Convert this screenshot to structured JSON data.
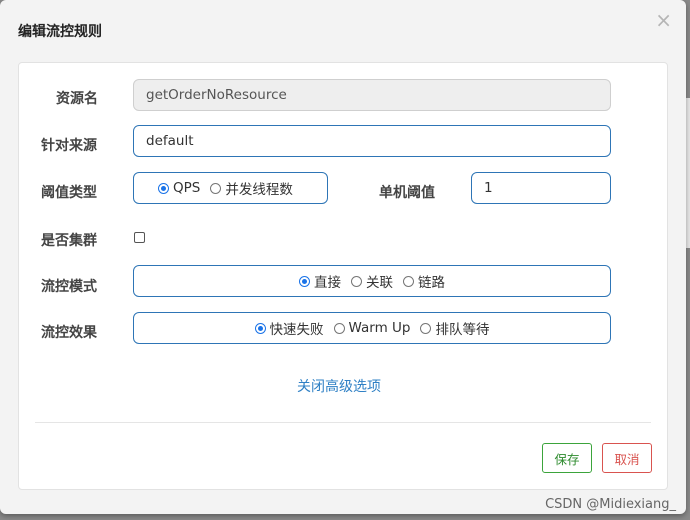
{
  "dialog": {
    "title": "编辑流控规则",
    "close_glyph": "×"
  },
  "form": {
    "resource_name": {
      "label": "资源名",
      "value": "getOrderNoResource",
      "disabled": true
    },
    "limit_app": {
      "label": "针对来源",
      "value": "default"
    },
    "threshold_type": {
      "label": "阈值类型",
      "options": [
        {
          "label": "QPS",
          "selected": true
        },
        {
          "label": "并发线程数",
          "selected": false
        }
      ]
    },
    "single_threshold": {
      "label": "单机阈值",
      "value": "1"
    },
    "cluster": {
      "label": "是否集群",
      "checked": false
    },
    "control_mode": {
      "label": "流控模式",
      "options": [
        {
          "label": "直接",
          "selected": true
        },
        {
          "label": "关联",
          "selected": false
        },
        {
          "label": "链路",
          "selected": false
        }
      ]
    },
    "control_effect": {
      "label": "流控效果",
      "options": [
        {
          "label": "快速失败",
          "selected": true
        },
        {
          "label": "Warm Up",
          "selected": false
        },
        {
          "label": "排队等待",
          "selected": false
        }
      ]
    },
    "advanced_toggle": "关闭高级选项"
  },
  "footer": {
    "save_label": "保存",
    "cancel_label": "取消"
  },
  "watermark": "CSDN @Midiexiang_",
  "colors": {
    "accent": "#2e75b6",
    "save": "#3ba43b",
    "cancel": "#d9534f",
    "link": "#2f80c5"
  }
}
